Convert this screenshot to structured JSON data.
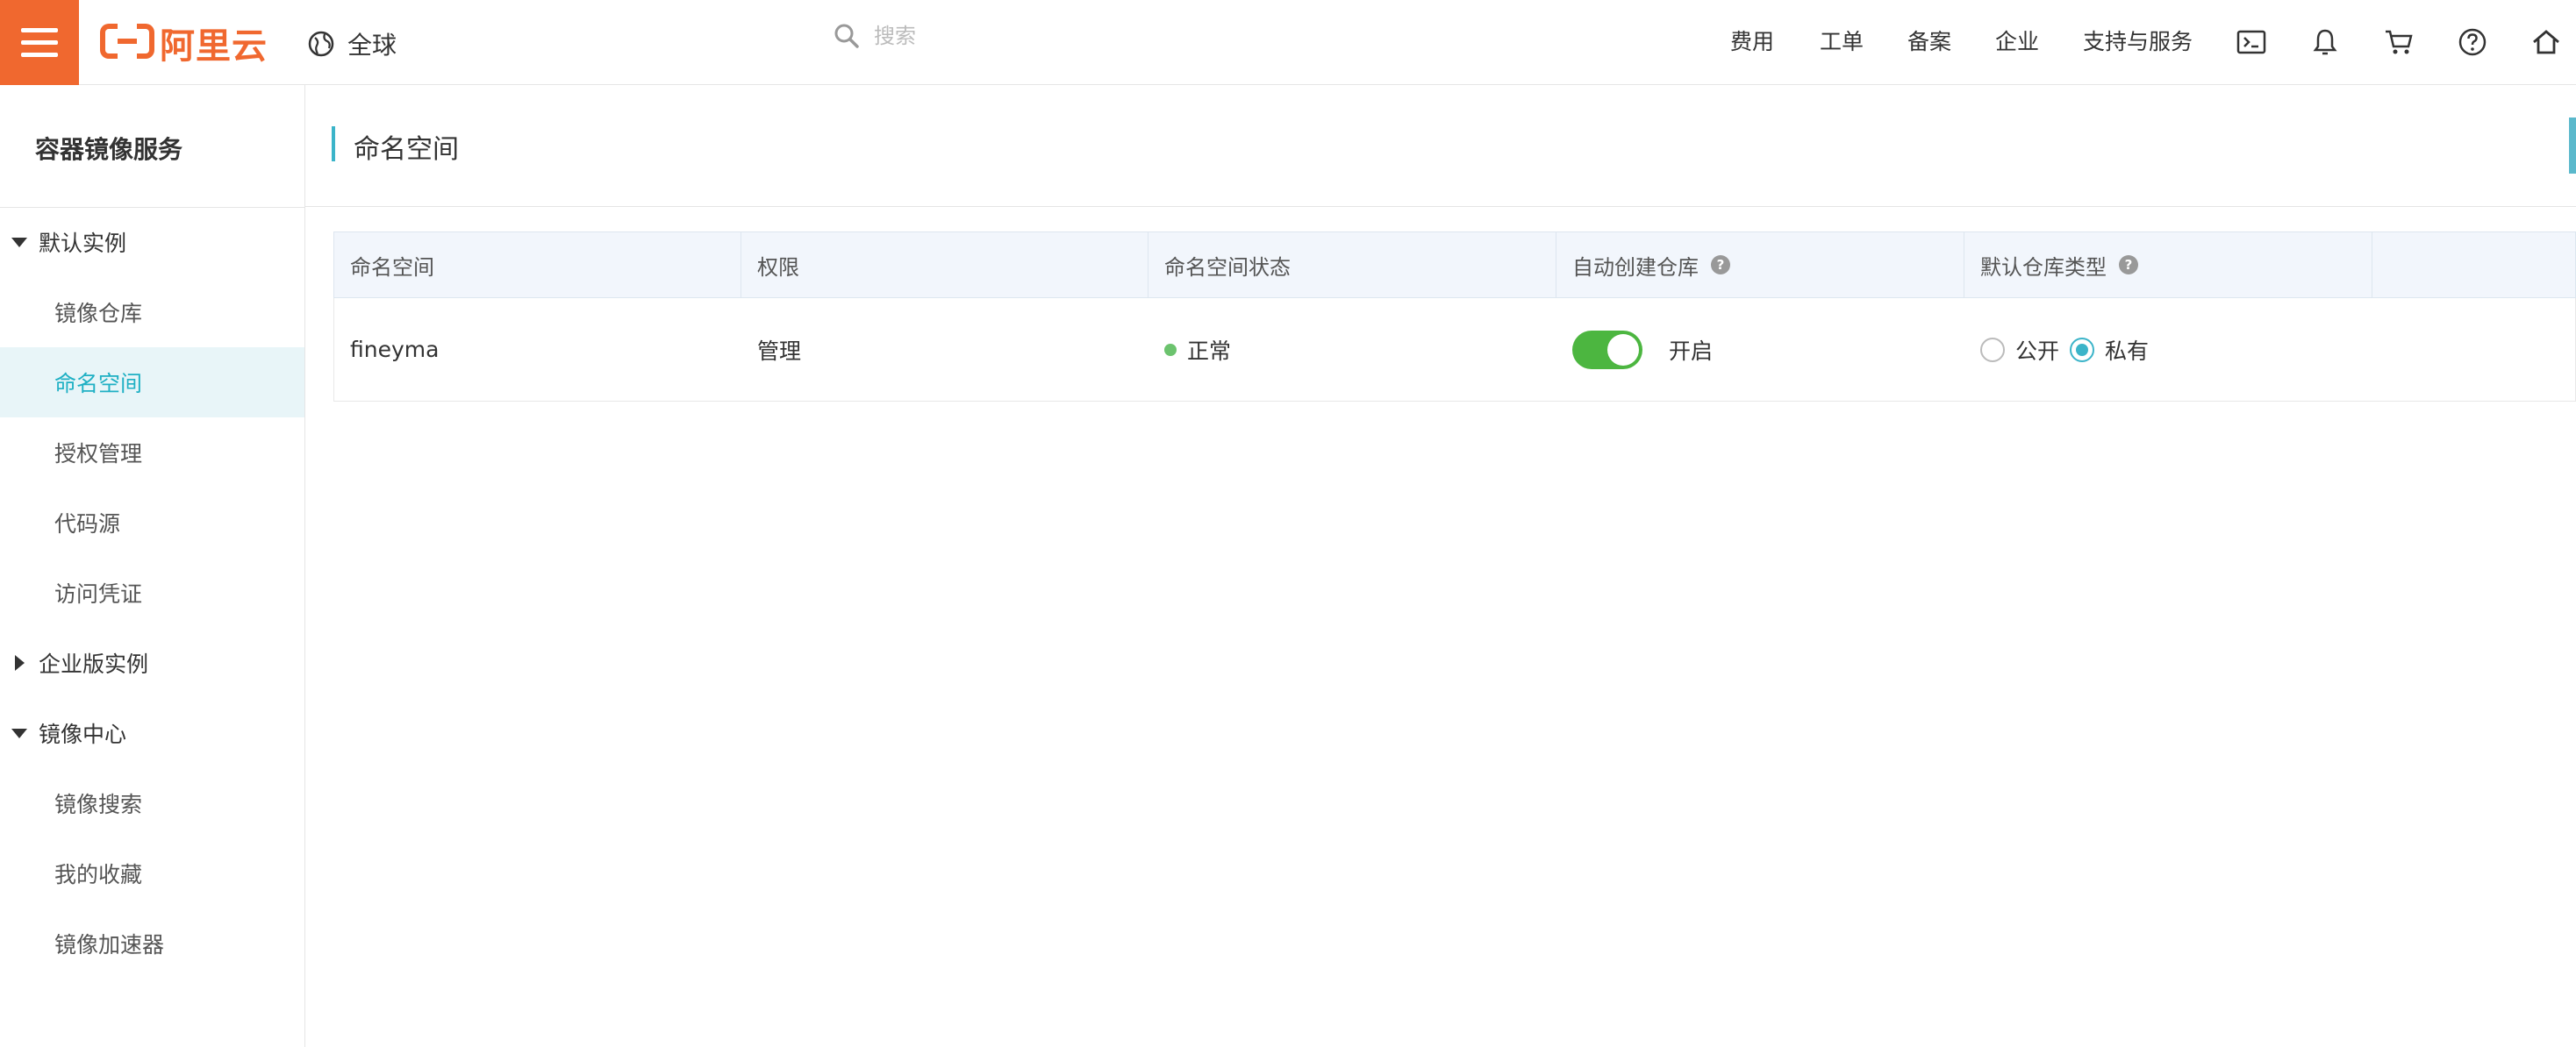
{
  "header": {
    "logo_text": "阿里云",
    "region_label": "全球",
    "search_placeholder": "搜索",
    "nav": [
      "费用",
      "工单",
      "备案",
      "企业",
      "支持与服务"
    ],
    "icons": [
      "terminal-icon",
      "bell-icon",
      "cart-icon",
      "help-icon",
      "home-icon"
    ],
    "brand_color": "#f0682f"
  },
  "sidebar": {
    "title": "容器镜像服务",
    "groups": [
      {
        "label": "默认实例",
        "expanded": true,
        "items": [
          "镜像仓库",
          "命名空间",
          "授权管理",
          "代码源",
          "访问凭证"
        ]
      },
      {
        "label": "企业版实例",
        "expanded": false,
        "items": []
      },
      {
        "label": "镜像中心",
        "expanded": true,
        "items": [
          "镜像搜索",
          "我的收藏",
          "镜像加速器"
        ]
      }
    ],
    "active_item": "命名空间"
  },
  "main": {
    "title": "命名空间",
    "table": {
      "headers": [
        "命名空间",
        "权限",
        "命名空间状态",
        "自动创建仓库",
        "默认仓库类型",
        ""
      ],
      "rows": [
        {
          "namespace": "fineyma",
          "permission": "管理",
          "status": "正常",
          "auto_create": true,
          "auto_create_label": "开启",
          "repo_type_options": [
            "公开",
            "私有"
          ],
          "repo_type_selected": "私有"
        }
      ]
    }
  },
  "colors": {
    "accent": "#3bb4c9",
    "toggle_on": "#4cb640",
    "status_ok": "#6cc36e"
  }
}
